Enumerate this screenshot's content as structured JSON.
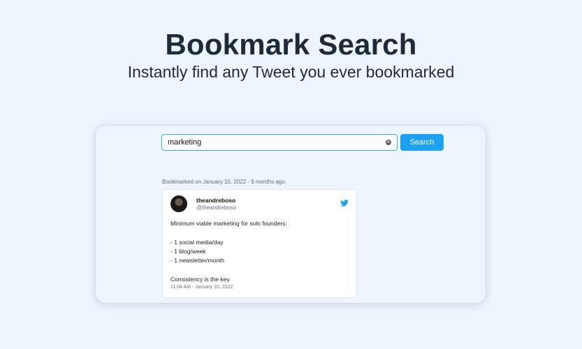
{
  "hero": {
    "title": "Bookmark Search",
    "subtitle": "Instantly find any Tweet you ever bookmarked"
  },
  "search": {
    "value": "marketing",
    "button_label": "Search"
  },
  "results": [
    {
      "bookmarked_text": "Bookmarked on January 10, 2022 - 9 months ago.",
      "tweet": {
        "author_name": "theandreboso",
        "author_handle": "@theandreboso",
        "lines": [
          "Minimum viable marketing for solo founders:",
          "",
          "- 1 social media/day",
          "- 1 blog/week",
          "- 1 newsletter/month",
          "",
          "Consistency is the key."
        ],
        "timestamp": "11:04 AM - January 10, 2022",
        "source_icon": "twitter-icon"
      }
    }
  ],
  "colors": {
    "accent": "#1da1f2",
    "background": "#eef5fd",
    "input_border": "#3ba7e3"
  }
}
